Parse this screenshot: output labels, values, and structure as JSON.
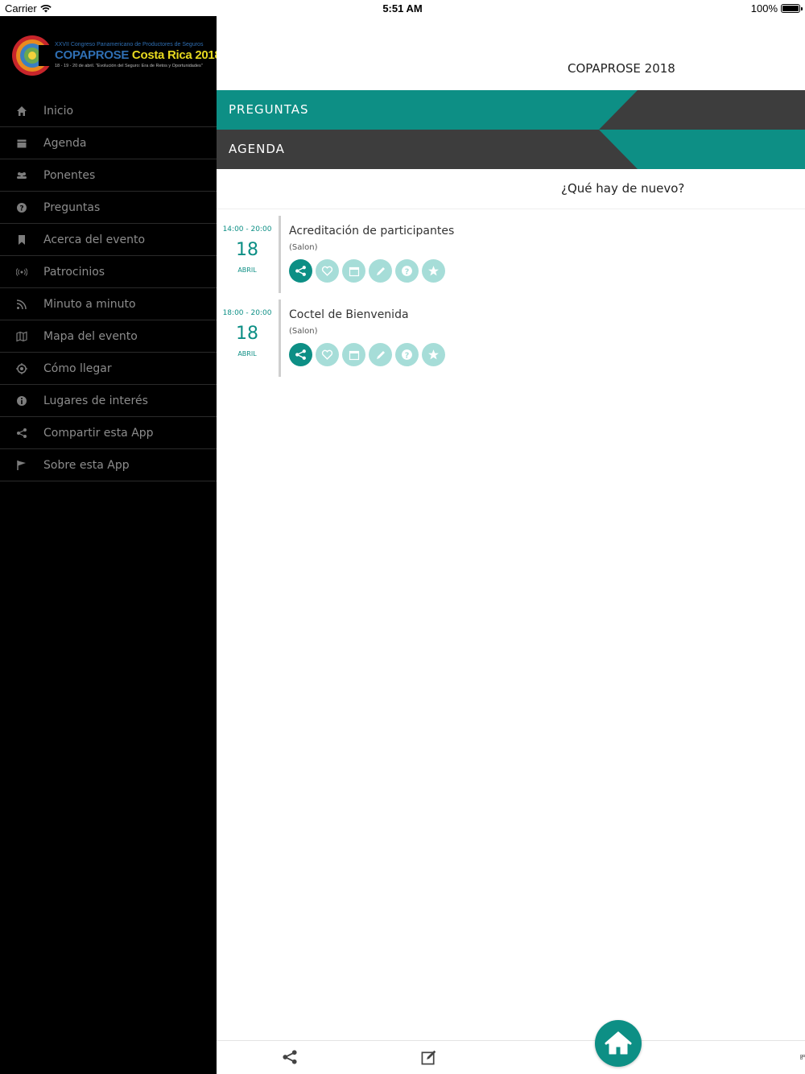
{
  "status_bar": {
    "carrier": "Carrier",
    "time": "5:51 AM",
    "battery": "100%",
    "battery_level": 1.0
  },
  "sidebar": {
    "logo": {
      "line1": "XXVII Congreso Panamericano de Productores de Seguros",
      "brand_blue": "COPAPROSE",
      "brand_yellow": "Costa Rica 2018",
      "line3": "18 - 19 - 20 de abril. \"Evolución del Seguro: Era de Retos y Oportunidades\""
    },
    "items": [
      {
        "label": "Inicio",
        "icon": "home-icon"
      },
      {
        "label": "Agenda",
        "icon": "calendar-icon"
      },
      {
        "label": "Ponentes",
        "icon": "people-icon"
      },
      {
        "label": "Preguntas",
        "icon": "question-icon"
      },
      {
        "label": "Acerca del evento",
        "icon": "bookmark-icon"
      },
      {
        "label": "Patrocinios",
        "icon": "broadcast-icon"
      },
      {
        "label": "Minuto a minuto",
        "icon": "rss-icon"
      },
      {
        "label": "Mapa del evento",
        "icon": "map-icon"
      },
      {
        "label": "Cómo llegar",
        "icon": "location-icon"
      },
      {
        "label": "Lugares de interés",
        "icon": "info-icon"
      },
      {
        "label": "Compartir esta App",
        "icon": "share-icon"
      },
      {
        "label": "Sobre esta App",
        "icon": "flag-icon"
      }
    ]
  },
  "main": {
    "title": "COPAPROSE 2018",
    "bands": {
      "preguntas": "PREGUNTAS",
      "agenda": "AGENDA"
    },
    "news_header": "¿Qué hay de nuevo?",
    "events": [
      {
        "time": "14:00 - 20:00",
        "day": "18",
        "month": "ABRIL",
        "name": "Acreditación de participantes",
        "room": "(Salon)"
      },
      {
        "time": "18:00 - 20:00",
        "day": "18",
        "month": "ABRIL",
        "name": "Coctel de Bienvenida",
        "room": "(Salon)"
      }
    ],
    "event_actions": [
      "share-icon",
      "heart-icon",
      "calendar-icon",
      "pencil-icon",
      "question-icon",
      "star-icon"
    ]
  },
  "tabbar": {
    "items": [
      "share-icon",
      "edit-icon",
      "home-icon",
      "qr-icon"
    ]
  },
  "colors": {
    "accent": "#0d8f85",
    "accent_light": "#a6ddd8",
    "dark_band": "#3d3d3d",
    "sidebar_bg": "#000000",
    "logo_blue": "#2f6fb3",
    "logo_yellow": "#e7d91f"
  }
}
